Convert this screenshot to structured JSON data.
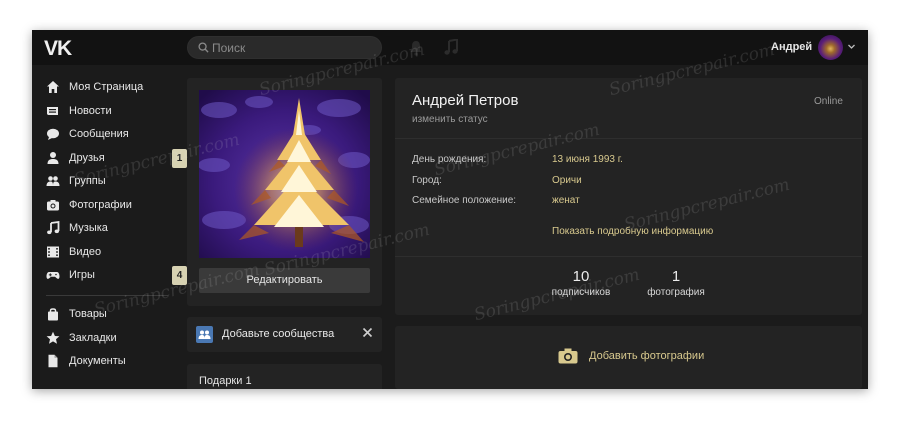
{
  "header": {
    "logo": "VK",
    "search_placeholder": "Поиск",
    "user_name": "Андрей"
  },
  "sidebar": {
    "items": [
      {
        "label": "Моя Страница",
        "icon": "home-icon"
      },
      {
        "label": "Новости",
        "icon": "news-icon"
      },
      {
        "label": "Сообщения",
        "icon": "messages-icon"
      },
      {
        "label": "Друзья",
        "icon": "friends-icon",
        "badge": "1"
      },
      {
        "label": "Группы",
        "icon": "groups-icon"
      },
      {
        "label": "Фотографии",
        "icon": "camera-icon"
      },
      {
        "label": "Музыка",
        "icon": "music-icon"
      },
      {
        "label": "Видео",
        "icon": "video-icon"
      },
      {
        "label": "Игры",
        "icon": "gamepad-icon",
        "badge": "4"
      },
      {
        "label": "Товары",
        "icon": "bag-icon"
      },
      {
        "label": "Закладки",
        "icon": "star-icon"
      },
      {
        "label": "Документы",
        "icon": "document-icon"
      }
    ]
  },
  "profile": {
    "edit_label": "Редактировать",
    "name": "Андрей Петров",
    "status_link": "изменить статус",
    "online": "Online",
    "info": [
      {
        "key": "День рождения:",
        "value": "13 июня 1993 г."
      },
      {
        "key": "Город:",
        "value": "Оричи"
      },
      {
        "key": "Семейное положение:",
        "value": "женат"
      }
    ],
    "more_info": "Показать подробную информацию",
    "stats": [
      {
        "count": "10",
        "label": "подписчиков"
      },
      {
        "count": "1",
        "label": "фотография"
      }
    ]
  },
  "add_communities": "Добавьте сообщества",
  "gifts": "Подарки  1",
  "add_photos": "Добавить фотографии",
  "watermark": "Soringpcrepair.com",
  "colors": {
    "background": "#1b1b1b",
    "panel": "#232323",
    "accent": "#d8c98e",
    "badge": "#d7d2b2"
  }
}
